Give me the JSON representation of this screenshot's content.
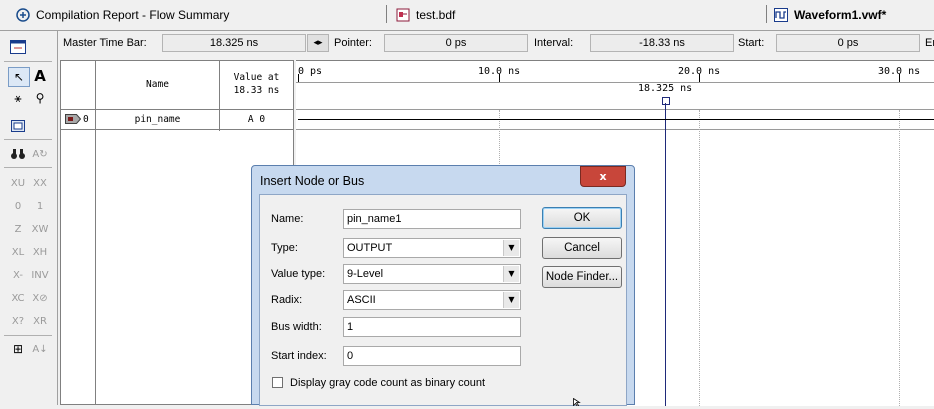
{
  "tabs": [
    {
      "label": "Compilation Report - Flow Summary"
    },
    {
      "label": "test.bdf"
    },
    {
      "label": "Waveform1.vwf*"
    }
  ],
  "infobar": {
    "master_label": "Master Time Bar:",
    "master_value": "18.325 ns",
    "pointer_label": "Pointer:",
    "pointer_value": "0 ps",
    "interval_label": "Interval:",
    "interval_value": "-18.33 ns",
    "start_label": "Start:",
    "start_value": "0 ps",
    "end_label": "Er"
  },
  "grid": {
    "col_name": "Name",
    "col_value_line1": "Value at",
    "col_value_line2": "18.33 ns",
    "rows": [
      {
        "index": "0",
        "name": "pin_name",
        "value": "A 0"
      }
    ]
  },
  "waveform": {
    "ticks": [
      "0 ps",
      "10.0 ns",
      "20.0 ns",
      "30.0 ns"
    ],
    "cursor_label": "18.325 ns"
  },
  "dialog": {
    "title": "Insert Node or Bus",
    "close": "x",
    "name_label": "Name:",
    "name_value": "pin_name1",
    "type_label": "Type:",
    "type_value": "OUTPUT",
    "value_type_label": "Value type:",
    "value_type_value": "9-Level",
    "radix_label": "Radix:",
    "radix_value": "ASCII",
    "bus_width_label": "Bus width:",
    "bus_width_value": "1",
    "start_index_label": "Start index:",
    "start_index_value": "0",
    "checkbox_label": "Display gray code count as binary count",
    "ok": "OK",
    "cancel": "Cancel",
    "node_finder": "Node Finder..."
  },
  "colors": {
    "dialog_frame": "#c7d9ef",
    "close_button": "#c8463a",
    "cursor_line": "#1f2a7a"
  }
}
